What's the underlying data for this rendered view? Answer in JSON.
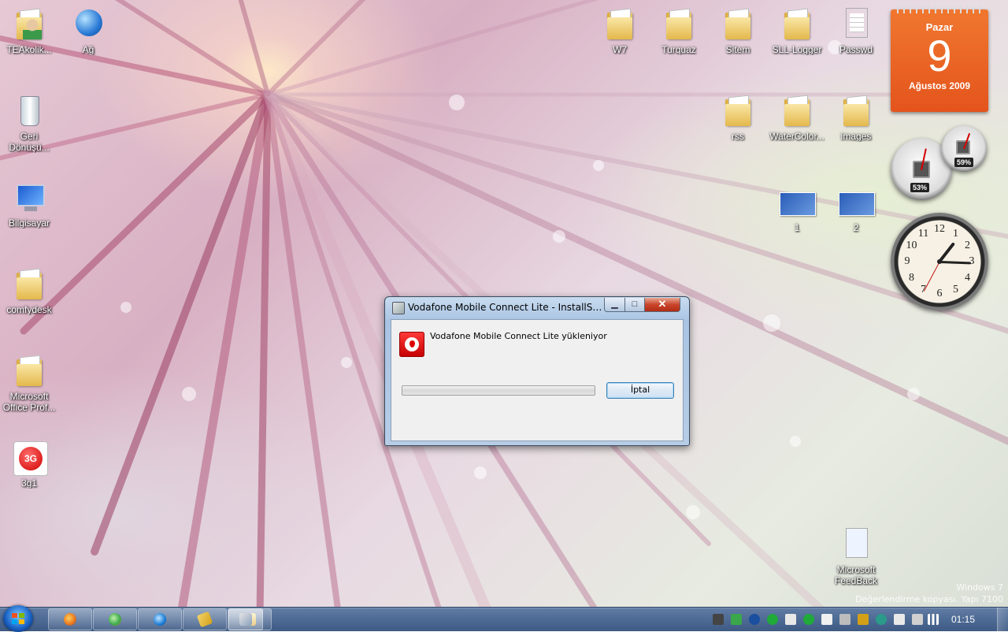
{
  "desktop": {
    "icons": {
      "teakolik": {
        "label": "TEAkolik...",
        "icon": "user-folder-icon"
      },
      "ag": {
        "label": "Ağ",
        "icon": "network-globe-icon"
      },
      "geri": {
        "label": "Geri Dönüşü...",
        "icon": "recycle-bin-icon"
      },
      "bilgisayar": {
        "label": "Bilgisayar",
        "icon": "computer-icon"
      },
      "comfydesk": {
        "label": "comfydesk",
        "icon": "folder-icon"
      },
      "office": {
        "label": "Microsoft Office Prof...",
        "icon": "folder-icon"
      },
      "g3": {
        "label": "3g1",
        "icon": "3g-icon"
      },
      "w7": {
        "label": "W7",
        "icon": "folder-icon"
      },
      "turquaz": {
        "label": "Turquaz",
        "icon": "folder-icon"
      },
      "sitem": {
        "label": "Sitem",
        "icon": "folder-icon"
      },
      "sll": {
        "label": "SLL-Logger",
        "icon": "folder-icon"
      },
      "passwd": {
        "label": "Passwd",
        "icon": "text-document-icon"
      },
      "rss": {
        "label": "rss",
        "icon": "folder-icon"
      },
      "watercolor": {
        "label": "WaterColor...",
        "icon": "folder-icon"
      },
      "images": {
        "label": "images",
        "icon": "folder-icon"
      },
      "img1": {
        "label": "1",
        "icon": "image-thumbnail-icon"
      },
      "img2": {
        "label": "2",
        "icon": "image-thumbnail-icon"
      },
      "feedback": {
        "label": "Microsoft FeedBack",
        "icon": "shortcut-document-icon"
      }
    },
    "watermark": {
      "line1": "Windows 7",
      "line2": "Değerlendirme kopyası. Yapı 7100"
    }
  },
  "gadgets": {
    "calendar": {
      "weekday": "Pazar",
      "day": "9",
      "month_year": "Ağustos 2009"
    },
    "cpu_meter": {
      "cpu_percent": "53%",
      "ram_percent": "59%"
    },
    "clock": {
      "numbers": [
        "12",
        "1",
        "2",
        "3",
        "4",
        "5",
        "6",
        "7",
        "8",
        "9",
        "10",
        "11"
      ],
      "time": "01:15"
    }
  },
  "dialog": {
    "title": "Vodafone Mobile Connect Lite - InstallShield...",
    "message": "Vodafone Mobile Connect Lite yükleniyor",
    "progress": 0,
    "cancel_label": "İptal",
    "minimize_symbol": "▁",
    "maximize_symbol": "□",
    "close_symbol": "✕",
    "accent": "#e60000"
  },
  "taskbar": {
    "buttons": [
      {
        "name": "firefox",
        "icon": "firefox-icon",
        "color": "#e8731c"
      },
      {
        "name": "media-player",
        "icon": "media-player-icon",
        "color": "#3aa84a"
      },
      {
        "name": "internet-explorer",
        "icon": "internet-explorer-icon",
        "color": "#1b7ed8"
      },
      {
        "name": "winamp",
        "icon": "winamp-icon",
        "color": "#d4a017"
      },
      {
        "name": "explorer",
        "icon": "folder-icon",
        "color": "#e6c35a"
      },
      {
        "name": "installshield",
        "icon": "installshield-icon",
        "color": "#8aa0bb"
      }
    ],
    "clock": "01:15"
  }
}
